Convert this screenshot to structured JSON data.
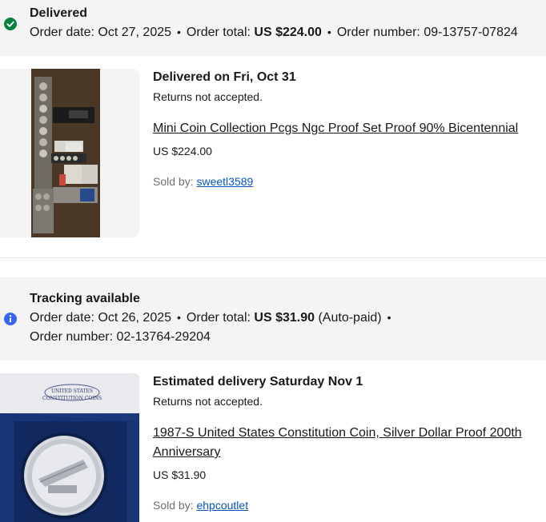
{
  "orders": [
    {
      "status": "Delivered",
      "status_icon": "check-circle-icon",
      "status_color": "#05823f",
      "order_date_label": "Order date:",
      "order_date": "Oct 27, 2025",
      "order_total_label": "Order total:",
      "order_total": "US $224.00",
      "order_number_label": "Order number:",
      "order_number": "09-13757-07824",
      "item": {
        "delivery_status": "Delivered on Fri, Oct 31",
        "returns": "Returns not accepted.",
        "title": "Mini Coin Collection Pcgs Ngc Proof Set Proof 90% Bicentennial",
        "price": "US $224.00",
        "sold_by_label": "Sold by:",
        "seller": "sweetl3589"
      }
    },
    {
      "status": "Tracking available",
      "status_icon": "info-circle-icon",
      "status_color": "#3665f3",
      "order_date_label": "Order date:",
      "order_date": "Oct 26, 2025",
      "order_total_label": "Order total:",
      "order_total": "US $31.90",
      "payment_note": "(Auto-paid)",
      "order_number_label": "Order number:",
      "order_number": "02-13764-29204",
      "item": {
        "delivery_status": "Estimated delivery Saturday Nov 1",
        "returns": "Returns not accepted.",
        "title": "1987-S United States Constitution Coin, Silver Dollar Proof 200th Anniversary",
        "price": "US $31.90",
        "sold_by_label": "Sold by:",
        "seller": "ehpcoutlet"
      }
    }
  ],
  "separator": "•"
}
